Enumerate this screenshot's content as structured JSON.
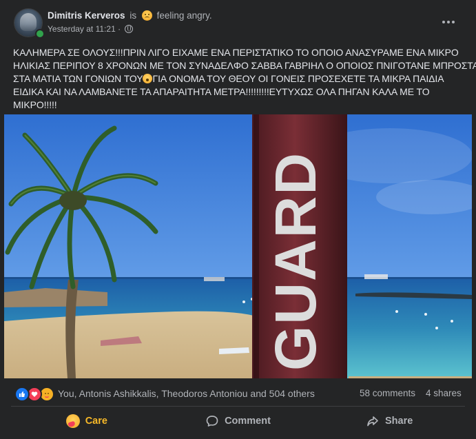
{
  "post": {
    "author": "Dimitris Kerveros",
    "is_text": "is",
    "feeling_icon": "angry-face-icon",
    "feeling": "feeling angry.",
    "timestamp": "Yesterday at 11:21",
    "separator": "·",
    "privacy_icon": "globe-icon",
    "text_lines": [
      "ΚΑΛΗΜΕΡΑ ΣΕ ΟΛΟΥΣ!!!ΠΡΙΝ ΛΙΓΟ ΕΙΧΑΜΕ ΕΝΑ ΠΕΡΙΣΤΑΤΙΚΟ  ΤΟ ΟΠΟΙΟ ΑΝΑΣΥΡΑΜΕ ΕΝΑ ΜΙΚΡΟ",
      "ΗΛΙΚΙΑΣ ΠΕΡΙΠΟΥ 8 ΧΡΟΝΩΝ ΜΕ ΤΟΝ ΣΥΝΑΔΕΛΦΟ ΣΑΒΒΑ ΓΑΒΡΙΗΛ Ο ΟΠΟΙΟΣ ΠΝΙΓΟΤΑΝΕ ΜΠΡΟΣΤΑ",
      "ΣΤΑ ΜΑΤΙΑ ΤΩΝ ΓΟΝΙΩΝ ΤΟΥ",
      "ΓΙΑ ΟΝΟΜΑ ΤΟΥ ΘΕΟΥ ΟΙ ΓΟΝΕΙΣ ΠΡΟΣΕΧΕΤΕ ΤΑ ΜΙΚΡΑ ΠΑΙΔΙΑ",
      "ΕΙΔΙΚΑ ΚΑΙ ΝΑ ΛΑΜΒΑΝΕΤΕ ΤΑ ΑΠΑΡΑΙΤΗΤΑ ΜΕΤΡΑ!!!!!!!!!ΕΥΤΥΧΩΣ ΟΛΑ ΠΗΓΑΝ ΚΑΛΑ ΜΕ ΤΟ",
      "ΜΙΚΡΟ!!!!!"
    ],
    "inline_emoji": "astonished-face-icon",
    "photo": {
      "sign_text": "GUARD"
    }
  },
  "reactions": {
    "icons": [
      "like-icon",
      "love-icon",
      "care-icon"
    ],
    "reactors": "You, Antonis Ashikkalis, Theodoros Antoniou and 504 others",
    "comments": "58 comments",
    "shares": "4 shares"
  },
  "actions": {
    "care_label": "Care",
    "comment_label": "Comment",
    "share_label": "Share"
  },
  "colors": {
    "background": "#242526",
    "care_accent": "#f7b928",
    "like_blue": "#1877f2",
    "love_red": "#f33e58",
    "secondary_text": "#b0b3b8"
  }
}
